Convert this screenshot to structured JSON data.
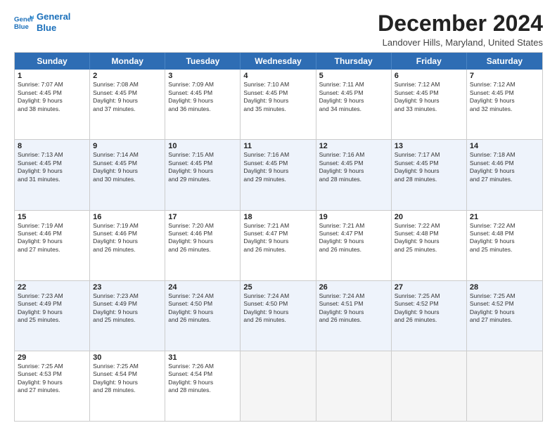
{
  "logo": {
    "line1": "General",
    "line2": "Blue"
  },
  "title": "December 2024",
  "location": "Landover Hills, Maryland, United States",
  "days_of_week": [
    "Sunday",
    "Monday",
    "Tuesday",
    "Wednesday",
    "Thursday",
    "Friday",
    "Saturday"
  ],
  "weeks": [
    [
      {
        "day": "1",
        "lines": [
          "Sunrise: 7:07 AM",
          "Sunset: 4:45 PM",
          "Daylight: 9 hours",
          "and 38 minutes."
        ]
      },
      {
        "day": "2",
        "lines": [
          "Sunrise: 7:08 AM",
          "Sunset: 4:45 PM",
          "Daylight: 9 hours",
          "and 37 minutes."
        ]
      },
      {
        "day": "3",
        "lines": [
          "Sunrise: 7:09 AM",
          "Sunset: 4:45 PM",
          "Daylight: 9 hours",
          "and 36 minutes."
        ]
      },
      {
        "day": "4",
        "lines": [
          "Sunrise: 7:10 AM",
          "Sunset: 4:45 PM",
          "Daylight: 9 hours",
          "and 35 minutes."
        ]
      },
      {
        "day": "5",
        "lines": [
          "Sunrise: 7:11 AM",
          "Sunset: 4:45 PM",
          "Daylight: 9 hours",
          "and 34 minutes."
        ]
      },
      {
        "day": "6",
        "lines": [
          "Sunrise: 7:12 AM",
          "Sunset: 4:45 PM",
          "Daylight: 9 hours",
          "and 33 minutes."
        ]
      },
      {
        "day": "7",
        "lines": [
          "Sunrise: 7:12 AM",
          "Sunset: 4:45 PM",
          "Daylight: 9 hours",
          "and 32 minutes."
        ]
      }
    ],
    [
      {
        "day": "8",
        "lines": [
          "Sunrise: 7:13 AM",
          "Sunset: 4:45 PM",
          "Daylight: 9 hours",
          "and 31 minutes."
        ]
      },
      {
        "day": "9",
        "lines": [
          "Sunrise: 7:14 AM",
          "Sunset: 4:45 PM",
          "Daylight: 9 hours",
          "and 30 minutes."
        ]
      },
      {
        "day": "10",
        "lines": [
          "Sunrise: 7:15 AM",
          "Sunset: 4:45 PM",
          "Daylight: 9 hours",
          "and 29 minutes."
        ]
      },
      {
        "day": "11",
        "lines": [
          "Sunrise: 7:16 AM",
          "Sunset: 4:45 PM",
          "Daylight: 9 hours",
          "and 29 minutes."
        ]
      },
      {
        "day": "12",
        "lines": [
          "Sunrise: 7:16 AM",
          "Sunset: 4:45 PM",
          "Daylight: 9 hours",
          "and 28 minutes."
        ]
      },
      {
        "day": "13",
        "lines": [
          "Sunrise: 7:17 AM",
          "Sunset: 4:45 PM",
          "Daylight: 9 hours",
          "and 28 minutes."
        ]
      },
      {
        "day": "14",
        "lines": [
          "Sunrise: 7:18 AM",
          "Sunset: 4:46 PM",
          "Daylight: 9 hours",
          "and 27 minutes."
        ]
      }
    ],
    [
      {
        "day": "15",
        "lines": [
          "Sunrise: 7:19 AM",
          "Sunset: 4:46 PM",
          "Daylight: 9 hours",
          "and 27 minutes."
        ]
      },
      {
        "day": "16",
        "lines": [
          "Sunrise: 7:19 AM",
          "Sunset: 4:46 PM",
          "Daylight: 9 hours",
          "and 26 minutes."
        ]
      },
      {
        "day": "17",
        "lines": [
          "Sunrise: 7:20 AM",
          "Sunset: 4:46 PM",
          "Daylight: 9 hours",
          "and 26 minutes."
        ]
      },
      {
        "day": "18",
        "lines": [
          "Sunrise: 7:21 AM",
          "Sunset: 4:47 PM",
          "Daylight: 9 hours",
          "and 26 minutes."
        ]
      },
      {
        "day": "19",
        "lines": [
          "Sunrise: 7:21 AM",
          "Sunset: 4:47 PM",
          "Daylight: 9 hours",
          "and 26 minutes."
        ]
      },
      {
        "day": "20",
        "lines": [
          "Sunrise: 7:22 AM",
          "Sunset: 4:48 PM",
          "Daylight: 9 hours",
          "and 25 minutes."
        ]
      },
      {
        "day": "21",
        "lines": [
          "Sunrise: 7:22 AM",
          "Sunset: 4:48 PM",
          "Daylight: 9 hours",
          "and 25 minutes."
        ]
      }
    ],
    [
      {
        "day": "22",
        "lines": [
          "Sunrise: 7:23 AM",
          "Sunset: 4:49 PM",
          "Daylight: 9 hours",
          "and 25 minutes."
        ]
      },
      {
        "day": "23",
        "lines": [
          "Sunrise: 7:23 AM",
          "Sunset: 4:49 PM",
          "Daylight: 9 hours",
          "and 25 minutes."
        ]
      },
      {
        "day": "24",
        "lines": [
          "Sunrise: 7:24 AM",
          "Sunset: 4:50 PM",
          "Daylight: 9 hours",
          "and 26 minutes."
        ]
      },
      {
        "day": "25",
        "lines": [
          "Sunrise: 7:24 AM",
          "Sunset: 4:50 PM",
          "Daylight: 9 hours",
          "and 26 minutes."
        ]
      },
      {
        "day": "26",
        "lines": [
          "Sunrise: 7:24 AM",
          "Sunset: 4:51 PM",
          "Daylight: 9 hours",
          "and 26 minutes."
        ]
      },
      {
        "day": "27",
        "lines": [
          "Sunrise: 7:25 AM",
          "Sunset: 4:52 PM",
          "Daylight: 9 hours",
          "and 26 minutes."
        ]
      },
      {
        "day": "28",
        "lines": [
          "Sunrise: 7:25 AM",
          "Sunset: 4:52 PM",
          "Daylight: 9 hours",
          "and 27 minutes."
        ]
      }
    ],
    [
      {
        "day": "29",
        "lines": [
          "Sunrise: 7:25 AM",
          "Sunset: 4:53 PM",
          "Daylight: 9 hours",
          "and 27 minutes."
        ]
      },
      {
        "day": "30",
        "lines": [
          "Sunrise: 7:25 AM",
          "Sunset: 4:54 PM",
          "Daylight: 9 hours",
          "and 28 minutes."
        ]
      },
      {
        "day": "31",
        "lines": [
          "Sunrise: 7:26 AM",
          "Sunset: 4:54 PM",
          "Daylight: 9 hours",
          "and 28 minutes."
        ]
      },
      {
        "day": "",
        "lines": []
      },
      {
        "day": "",
        "lines": []
      },
      {
        "day": "",
        "lines": []
      },
      {
        "day": "",
        "lines": []
      }
    ]
  ]
}
